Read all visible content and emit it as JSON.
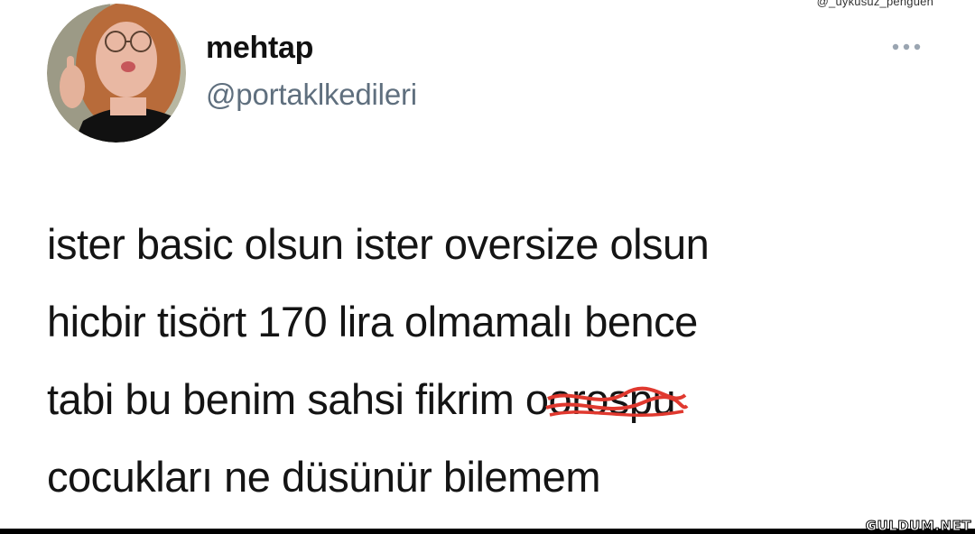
{
  "watermark_top": "@_uykusuz_penguen",
  "tweet": {
    "author_name": "mehtap",
    "author_handle": "@portaklkedileri",
    "more_icon": "more-horizontal-icon",
    "lines": [
      "ister basic olsun ister oversize olsun",
      "hicbir tisört 170 lira olmamalı bence",
      "tabi bu benim sahsi fikrim o",
      "cocukları ne düsünür bilemem"
    ],
    "scribbled_word": "orospu",
    "scribble_color": "#e0392f"
  },
  "site_watermark": "GULDUM.NET",
  "colors": {
    "text": "#141414",
    "handle": "#5f6f7e",
    "dots": "#9aa5b1"
  }
}
